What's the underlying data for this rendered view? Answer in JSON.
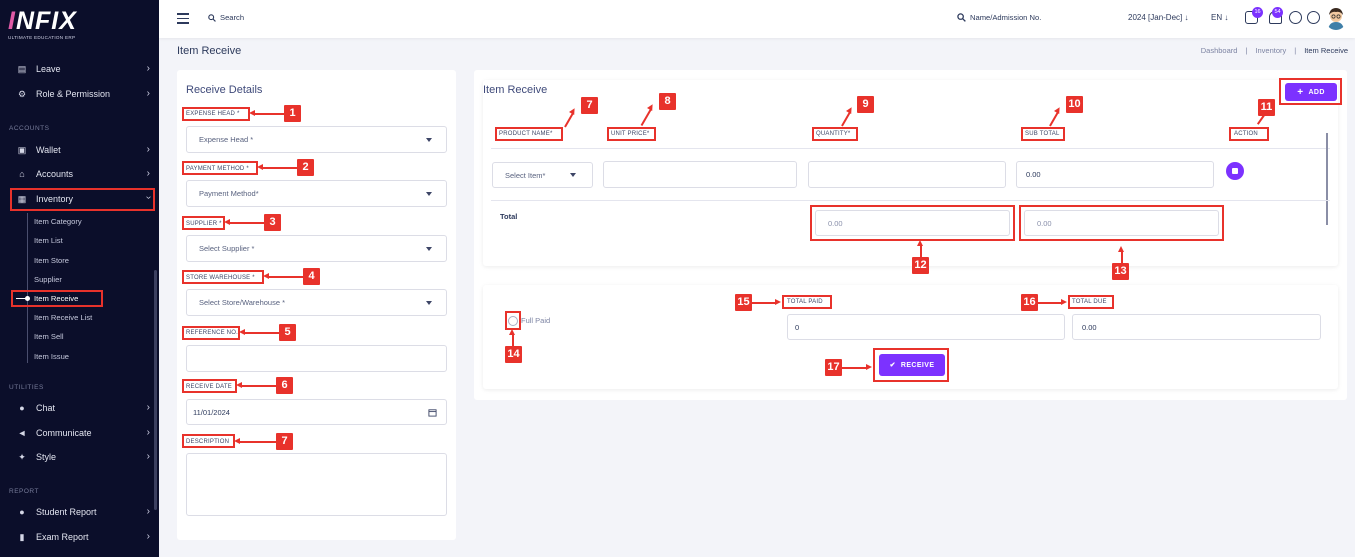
{
  "app": {
    "logo_main_a": "I",
    "logo_main_b": "NFIX",
    "logo_sub": "ULTIMATE EDUCATION ERP"
  },
  "topbar": {
    "search_label": "Search",
    "student_search_label": "Name/Admission No.",
    "academic_year": "2024 [Jan-Dec]",
    "language": "EN",
    "message_badge": "16",
    "notification_badge": "54"
  },
  "sidebar": {
    "items_top": [
      {
        "label": "Leave"
      },
      {
        "label": "Role & Permission"
      }
    ],
    "section_accounts": "ACCOUNTS",
    "wallet": "Wallet",
    "accounts": "Accounts",
    "inventory": "Inventory",
    "inventory_sub": [
      "Item Category",
      "Item List",
      "Item Store",
      "Supplier",
      "Item Receive",
      "Item Receive List",
      "Item Sell",
      "Item Issue"
    ],
    "section_utilities": "UTILITIES",
    "chat": "Chat",
    "communicate": "Communicate",
    "style": "Style",
    "section_report": "REPORT",
    "student_report": "Student Report",
    "exam_report": "Exam Report"
  },
  "page": {
    "title": "Item Receive",
    "breadcrumb": [
      "Dashboard",
      "Inventory",
      "Item Receive"
    ]
  },
  "receive_details": {
    "title": "Receive Details",
    "expense_head_label": "EXPENSE HEAD *",
    "expense_head_value": "Expense Head *",
    "payment_method_label": "PAYMENT METHOD *",
    "payment_method_value": "Payment Method*",
    "supplier_label": "SUPPLIER *",
    "supplier_value": "Select Supplier *",
    "store_label": "STORE WAREHOUSE *",
    "store_value": "Select Store/Warehouse *",
    "reference_label": "REFERENCE NO.",
    "reference_value": "",
    "receive_date_label": "RECEIVE DATE",
    "receive_date_value": "11/01/2024",
    "description_label": "DESCRIPTION",
    "description_value": ""
  },
  "item_receive": {
    "title": "Item Receive",
    "add_button": "ADD",
    "columns": [
      "PRODUCT NAME*",
      "UNIT PRICE*",
      "QUANTITY*",
      "SUB TOTAL",
      "ACTION"
    ],
    "row": {
      "product": "Select Item*",
      "unit_price": "",
      "quantity": "",
      "sub_total": "0.00"
    },
    "total_label": "Total",
    "total_quantity": "0.00",
    "total_subtotal": "0.00"
  },
  "payment": {
    "full_paid_label": "Full Paid",
    "total_paid_label": "TOTAL PAID",
    "total_paid_value": "0",
    "total_due_label": "TOTAL DUE",
    "total_due_value": "0.00",
    "receive_button": "RECEIVE"
  },
  "annotations": [
    "1",
    "2",
    "3",
    "4",
    "5",
    "6",
    "7",
    "7",
    "8",
    "9",
    "10",
    "11",
    "12",
    "13",
    "14",
    "15",
    "16",
    "17"
  ],
  "colors": {
    "accent": "#7c32ff",
    "annotation": "#e8322b",
    "sidebar_bg": "#0b0e2a"
  }
}
